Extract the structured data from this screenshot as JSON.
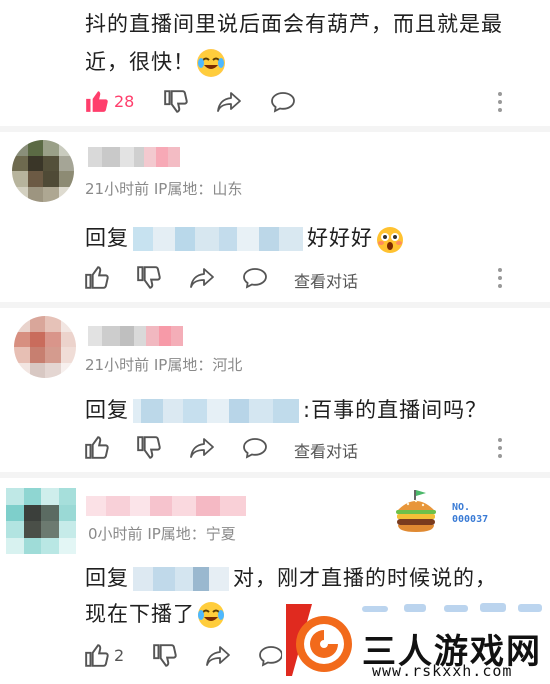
{
  "top_comment": {
    "text_line1": "抖的直播间里说后面会有葫芦，而且就是最",
    "text_line2": "近，很快！",
    "like_count": "28"
  },
  "replies": [
    {
      "time": "21小时前",
      "ip": "IP属地：山东",
      "reply_prefix": "回复",
      "reply_text": "好好好",
      "view_conversation": "查看对话"
    },
    {
      "time": "21小时前",
      "ip": "IP属地：河北",
      "reply_prefix": "回复",
      "reply_text": ":百事的直播间吗？",
      "view_conversation": "查看对话"
    },
    {
      "time": "0小时前",
      "ip": "IP属地：宁夏",
      "reply_prefix": "回复",
      "reply_text_line1": "对，刚才直播的时候说的，",
      "reply_text_line2": "现在下播了",
      "like_count": "2",
      "badge_text": "NO.\n000037"
    }
  ],
  "watermark": {
    "title": "三人游戏网",
    "url": "www.rskxxh.com"
  },
  "colors": {
    "like_active": "#ff3e6c",
    "text": "#1f1f1f",
    "meta": "#8a8a8a",
    "watermark_orange": "#f26a1b",
    "watermark_red": "#e02a1f"
  }
}
